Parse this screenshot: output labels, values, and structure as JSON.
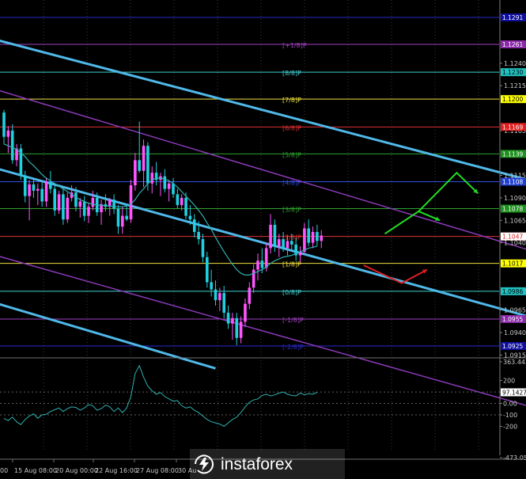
{
  "chart_data": {
    "type": "candlestick",
    "price_range": [
      1.09,
      1.129
    ],
    "price_ticks": [
      "1.1240",
      "1.1215",
      "1.1165",
      "1.1115",
      "1.1090",
      "1.1065",
      "1.1040",
      "1.0965",
      "1.0940",
      "1.0915"
    ],
    "murrey_levels": [
      {
        "label": "",
        "price": 1.1291,
        "tag": "1.1291",
        "color": "#2a2ad0",
        "tag_bg": "#1010a0",
        "tag_fg": "#ffffff"
      },
      {
        "label": "[+1/8]P",
        "price": 1.1261,
        "tag": "1.1261",
        "color": "#a040c0",
        "tag_bg": "#8a2aa8",
        "tag_fg": "#ffffff"
      },
      {
        "label": "[8/8]P",
        "price": 1.123,
        "tag": "1.1230",
        "color": "#40d0d0",
        "tag_bg": "#20c0c0",
        "tag_fg": "#000000"
      },
      {
        "label": "[7/8]P",
        "price": 1.12,
        "tag": "1.1200",
        "color": "#f0e040",
        "tag_bg": "#ffff00",
        "tag_fg": "#000000"
      },
      {
        "label": "[6/8]P",
        "price": 1.1169,
        "tag": "1.1169",
        "color": "#e03030",
        "tag_bg": "#e02020",
        "tag_fg": "#ffffff"
      },
      {
        "label": "[5/8]P",
        "price": 1.1139,
        "tag": "1.1139",
        "color": "#30a030",
        "tag_bg": "#209020",
        "tag_fg": "#ffffff"
      },
      {
        "label": "[4/8]P",
        "price": 1.1108,
        "tag": "1.1108",
        "color": "#3050e0",
        "tag_bg": "#2040d0",
        "tag_fg": "#ffffff"
      },
      {
        "label": "[3/8]P",
        "price": 1.1078,
        "tag": "1.1078",
        "color": "#30a030",
        "tag_bg": "#209020",
        "tag_fg": "#ffffff"
      },
      {
        "label": "[2/8]P",
        "price": 1.1047,
        "tag": "1.1047",
        "color": "#e03030",
        "tag_bg": "#e02020",
        "tag_fg": "#ffffff"
      },
      {
        "label": "[1/8]P",
        "price": 1.1017,
        "tag": "1.1017",
        "color": "#f0e040",
        "tag_bg": "#ffff00",
        "tag_fg": "#000000"
      },
      {
        "label": "[0/8]P",
        "price": 1.0986,
        "tag": "1.0986",
        "color": "#40d0d0",
        "tag_bg": "#20c0c0",
        "tag_fg": "#000000"
      },
      {
        "label": "[-1/8]P",
        "price": 1.0955,
        "tag": "1.0955",
        "color": "#a040c0",
        "tag_bg": "#8a2aa8",
        "tag_fg": "#ffffff"
      },
      {
        "label": "[-2/8]P",
        "price": 1.0925,
        "tag": "1.0925",
        "color": "#2a2ad0",
        "tag_bg": "#1010a0",
        "tag_fg": "#ffffff"
      }
    ],
    "current_price": {
      "tag": "1.1047",
      "tag_bg": "#ffffff",
      "tag_fg": "#e02020"
    },
    "channels": [
      {
        "color": "#4fb8e8",
        "width": 3,
        "from": {
          "bar": -5,
          "price": 1.127
        },
        "to": {
          "bar": 136,
          "price": 1.1095
        }
      },
      {
        "color": "#4fb8e8",
        "width": 3,
        "from": {
          "bar": -5,
          "price": 1.1127
        },
        "to": {
          "bar": 136,
          "price": 1.0942
        }
      },
      {
        "color": "#4fb8e8",
        "width": 3,
        "from": {
          "bar": -5,
          "price": 1.0977
        },
        "to": {
          "bar": 50,
          "price": 1.09
        }
      },
      {
        "color": "#8a3ab8",
        "width": 1.5,
        "from": {
          "bar": -5,
          "price": 1.1215
        },
        "to": {
          "bar": 136,
          "price": 1.1015
        }
      },
      {
        "color": "#8a3ab8",
        "width": 1.5,
        "from": {
          "bar": -5,
          "price": 1.103
        },
        "to": {
          "bar": 136,
          "price": 1.0842
        }
      }
    ],
    "arrows": [
      {
        "color": "#22dd22",
        "points": [
          {
            "bar": 90,
            "price": 1.105
          },
          {
            "bar": 98,
            "price": 1.1075
          },
          {
            "bar": 103,
            "price": 1.1065
          }
        ]
      },
      {
        "color": "#22dd22",
        "points": [
          {
            "bar": 98,
            "price": 1.1075
          },
          {
            "bar": 107,
            "price": 1.1118
          },
          {
            "bar": 112,
            "price": 1.1095
          }
        ]
      },
      {
        "color": "#dd2020",
        "points": [
          {
            "bar": 85,
            "price": 1.1015
          },
          {
            "bar": 94,
            "price": 1.0995
          },
          {
            "bar": 100,
            "price": 1.101
          }
        ]
      }
    ],
    "ohlc": [
      [
        1.1185,
        1.1188,
        1.115,
        1.1158
      ],
      [
        1.1158,
        1.117,
        1.114,
        1.1165
      ],
      [
        1.1165,
        1.1172,
        1.1128,
        1.1132
      ],
      [
        1.1132,
        1.115,
        1.1125,
        1.1145
      ],
      [
        1.1145,
        1.115,
        1.111,
        1.1115
      ],
      [
        1.1115,
        1.112,
        1.1085,
        1.1092
      ],
      [
        1.1092,
        1.111,
        1.1065,
        1.1105
      ],
      [
        1.1105,
        1.1112,
        1.109,
        1.1098
      ],
      [
        1.1098,
        1.1106,
        1.1082,
        1.11
      ],
      [
        1.11,
        1.1108,
        1.108,
        1.1086
      ],
      [
        1.1086,
        1.1112,
        1.108,
        1.1108
      ],
      [
        1.1108,
        1.112,
        1.1095,
        1.11
      ],
      [
        1.11,
        1.1104,
        1.107,
        1.1076
      ],
      [
        1.1076,
        1.1098,
        1.1072,
        1.1094
      ],
      [
        1.1094,
        1.11,
        1.106,
        1.1066
      ],
      [
        1.1066,
        1.1096,
        1.1062,
        1.109
      ],
      [
        1.109,
        1.1104,
        1.1086,
        1.1096
      ],
      [
        1.1096,
        1.1102,
        1.1075,
        1.108
      ],
      [
        1.108,
        1.109,
        1.1068,
        1.1086
      ],
      [
        1.1086,
        1.1092,
        1.1064,
        1.107
      ],
      [
        1.107,
        1.1085,
        1.1062,
        1.108
      ],
      [
        1.108,
        1.1098,
        1.1076,
        1.109
      ],
      [
        1.109,
        1.1096,
        1.107,
        1.1074
      ],
      [
        1.1074,
        1.1088,
        1.106,
        1.1083
      ],
      [
        1.1083,
        1.1094,
        1.1075,
        1.108
      ],
      [
        1.108,
        1.109,
        1.107,
        1.1088
      ],
      [
        1.1088,
        1.1094,
        1.1072,
        1.1078
      ],
      [
        1.1078,
        1.1082,
        1.105,
        1.1058
      ],
      [
        1.1058,
        1.108,
        1.105,
        1.107
      ],
      [
        1.107,
        1.1082,
        1.1064,
        1.1066
      ],
      [
        1.1066,
        1.111,
        1.1062,
        1.1104
      ],
      [
        1.1104,
        1.114,
        1.1098,
        1.1132
      ],
      [
        1.1132,
        1.1175,
        1.1118,
        1.112
      ],
      [
        1.112,
        1.1155,
        1.1102,
        1.1148
      ],
      [
        1.1148,
        1.1152,
        1.1098,
        1.1106
      ],
      [
        1.1106,
        1.1125,
        1.1095,
        1.1118
      ],
      [
        1.1118,
        1.113,
        1.1104,
        1.111
      ],
      [
        1.111,
        1.1118,
        1.1092,
        1.1114
      ],
      [
        1.1114,
        1.1122,
        1.1096,
        1.11
      ],
      [
        1.11,
        1.111,
        1.1086,
        1.1106
      ],
      [
        1.1106,
        1.1112,
        1.109,
        1.1094
      ],
      [
        1.1094,
        1.11,
        1.1078,
        1.1082
      ],
      [
        1.1082,
        1.1094,
        1.1076,
        1.109
      ],
      [
        1.109,
        1.1096,
        1.1066,
        1.107
      ],
      [
        1.107,
        1.1082,
        1.106,
        1.1066
      ],
      [
        1.1066,
        1.1072,
        1.1046,
        1.1052
      ],
      [
        1.1052,
        1.1064,
        1.1038,
        1.1044
      ],
      [
        1.1044,
        1.105,
        1.1018,
        1.1024
      ],
      [
        1.1024,
        1.103,
        1.099,
        1.0996
      ],
      [
        1.0996,
        1.101,
        1.098,
        1.0988
      ],
      [
        1.0988,
        1.0998,
        1.097,
        1.0976
      ],
      [
        1.0976,
        1.099,
        1.0964,
        1.0984
      ],
      [
        1.0984,
        1.0992,
        1.0956,
        1.0962
      ],
      [
        1.0962,
        1.097,
        1.0944,
        1.095
      ],
      [
        1.095,
        1.0962,
        1.0932,
        1.0956
      ],
      [
        1.0956,
        1.0962,
        1.0926,
        1.0934
      ],
      [
        1.0934,
        1.0958,
        1.0928,
        1.0952
      ],
      [
        1.0952,
        1.0978,
        1.0946,
        1.0972
      ],
      [
        1.0972,
        1.0996,
        1.0966,
        1.099
      ],
      [
        1.099,
        1.1016,
        1.0984,
        1.101
      ],
      [
        1.101,
        1.1028,
        1.0998,
        1.102
      ],
      [
        1.102,
        1.1034,
        1.1006,
        1.1012
      ],
      [
        1.1012,
        1.104,
        1.1008,
        1.1034
      ],
      [
        1.1034,
        1.1072,
        1.1028,
        1.106
      ],
      [
        1.106,
        1.1066,
        1.103,
        1.1036
      ],
      [
        1.1036,
        1.105,
        1.1024,
        1.1044
      ],
      [
        1.1044,
        1.1052,
        1.103,
        1.1034
      ],
      [
        1.1034,
        1.1048,
        1.1026,
        1.1042
      ],
      [
        1.1042,
        1.105,
        1.1032,
        1.1038
      ],
      [
        1.1038,
        1.1046,
        1.102,
        1.1026
      ],
      [
        1.1026,
        1.1036,
        1.1018,
        1.103
      ],
      [
        1.103,
        1.1062,
        1.1028,
        1.1056
      ],
      [
        1.1056,
        1.1066,
        1.1036,
        1.104
      ],
      [
        1.104,
        1.1058,
        1.1034,
        1.1052
      ],
      [
        1.1052,
        1.106,
        1.1036,
        1.1042
      ],
      [
        1.1042,
        1.1054,
        1.1034,
        1.1048
      ]
    ],
    "moving_average": [
      1.115,
      1.1148,
      1.1146,
      1.1144,
      1.114,
      1.1136,
      1.113,
      1.1126,
      1.1121,
      1.1116,
      1.1112,
      1.1109,
      1.1106,
      1.1103,
      1.11,
      1.1097,
      1.1094,
      1.1091,
      1.1088,
      1.1086,
      1.1084,
      1.1083,
      1.1082,
      1.1082,
      1.1081,
      1.1081,
      1.108,
      1.108,
      1.108,
      1.1081,
      1.1083,
      1.1088,
      1.1095,
      1.11,
      1.1106,
      1.111,
      1.1112,
      1.1112,
      1.1111,
      1.1109,
      1.1106,
      1.1102,
      1.1097,
      1.1092,
      1.1087,
      1.1082,
      1.1076,
      1.107,
      1.1062,
      1.1055,
      1.1046,
      1.1038,
      1.103,
      1.1023,
      1.1016,
      1.101,
      1.1006,
      1.1004,
      1.1004,
      1.1006,
      1.1008,
      1.101,
      1.1013,
      1.1017,
      1.102,
      1.1022,
      1.1024,
      1.1025,
      1.1026,
      1.1028,
      1.103,
      1.1032,
      1.1034,
      1.1035,
      1.1036
    ],
    "cci": {
      "ticks": [
        "363.4436",
        "200",
        "100",
        "0.00",
        "-100",
        "-200",
        "-473.0535"
      ],
      "current_tag": "97.1427",
      "levels": [
        363,
        200,
        100,
        0,
        -100,
        -200,
        -473
      ],
      "values": [
        -130,
        -150,
        -120,
        -160,
        -185,
        -140,
        -110,
        -90,
        -130,
        -100,
        -95,
        -70,
        -55,
        -40,
        -70,
        -45,
        -30,
        -35,
        -60,
        -40,
        -10,
        -20,
        -60,
        -45,
        -15,
        -30,
        -70,
        -40,
        -80,
        -40,
        60,
        260,
        330,
        230,
        150,
        110,
        80,
        95,
        60,
        40,
        20,
        25,
        -20,
        -40,
        -30,
        -60,
        -80,
        -110,
        -140,
        -160,
        -170,
        -180,
        -200,
        -170,
        -140,
        -120,
        -80,
        -30,
        10,
        30,
        40,
        70,
        80,
        65,
        75,
        90,
        100,
        80,
        70,
        65,
        90,
        75,
        85,
        80,
        97
      ]
    },
    "time_labels": [
      "15 Aug 08:00",
      "20 Aug 00:00",
      "22 Aug 16:00",
      "27 Aug 08:00",
      "30 Au"
    ],
    "time_label_first": "00"
  },
  "watermark": {
    "text": "instaforex"
  }
}
